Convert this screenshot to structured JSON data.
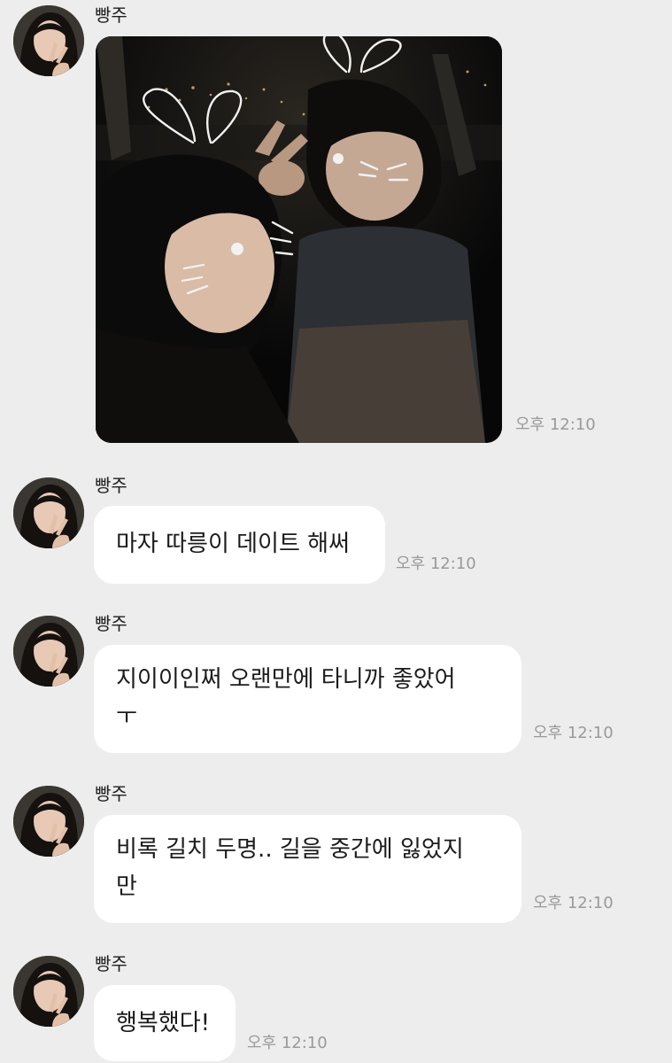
{
  "messages": [
    {
      "sender": "빵주",
      "type": "photo",
      "time": "오후 12:10"
    },
    {
      "sender": "빵주",
      "type": "text",
      "lines": [
        "마자 따릉이 데이트 해써"
      ],
      "time": "오후 12:10"
    },
    {
      "sender": "빵주",
      "type": "text",
      "lines": [
        "지이이인쩌 오랜만에 타니까 좋았어",
        "ㅜ"
      ],
      "time": "오후 12:10"
    },
    {
      "sender": "빵주",
      "type": "text",
      "lines": [
        "비록 길치 두명.. 길을 중간에 잃었지",
        "만"
      ],
      "time": "오후 12:10"
    },
    {
      "sender": "빵주",
      "type": "text",
      "lines": [
        "행복했다!"
      ],
      "time": "오후 12:10"
    }
  ],
  "icons": {
    "avatar": "profile-photo",
    "photo": "night-selfie-with-bunny-doodles"
  },
  "colors": {
    "background": "#ededed",
    "bubble": "#ffffff",
    "timestamp": "#9a9a9a"
  }
}
